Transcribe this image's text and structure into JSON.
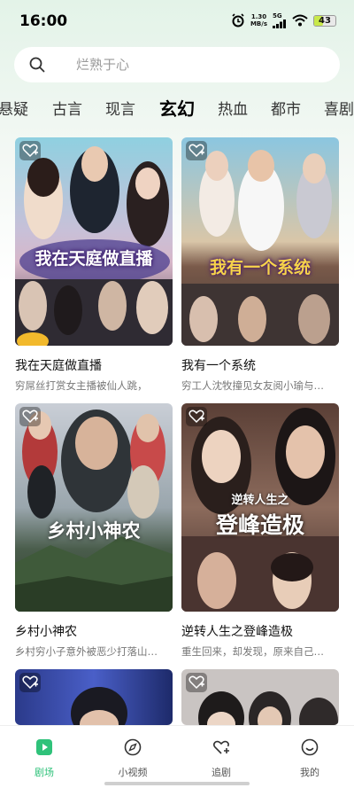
{
  "status_bar": {
    "time": "16:00",
    "net_speed_value": "1.30",
    "net_speed_unit": "MB/s",
    "signal": "5G",
    "battery": "43"
  },
  "search": {
    "placeholder": "烂熟于心"
  },
  "categories": [
    "悬疑",
    "古言",
    "现言",
    "玄幻",
    "热血",
    "都市",
    "喜剧"
  ],
  "active_category": "玄幻",
  "cards": [
    {
      "title": "我在天庭做直播",
      "desc": "穷屌丝打赏女主播被仙人跳，",
      "poster_text": "我在天庭做直播"
    },
    {
      "title": "我有一个系统",
      "desc": "穷工人沈牧撞见女友阅小瑜与…",
      "poster_text": "我有一个系统"
    },
    {
      "title": "乡村小神农",
      "desc": "乡村穷小子意外被恶少打落山…",
      "poster_text": "乡村小神农"
    },
    {
      "title": "逆转人生之登峰造极",
      "desc": "重生回来，却发现，原来自己…",
      "poster_text_top": "逆转人生之",
      "poster_text_main": "登峰造极"
    }
  ],
  "bottom_nav": [
    {
      "label": "剧场",
      "icon": "play-square-icon",
      "active": true
    },
    {
      "label": "小视频",
      "icon": "compass-icon",
      "active": false
    },
    {
      "label": "追剧",
      "icon": "heart-plus-icon",
      "active": false
    },
    {
      "label": "我的",
      "icon": "smiley-icon",
      "active": false
    }
  ],
  "colors": {
    "accent": "#2fc27a",
    "background_top": "#e3f3e8"
  }
}
